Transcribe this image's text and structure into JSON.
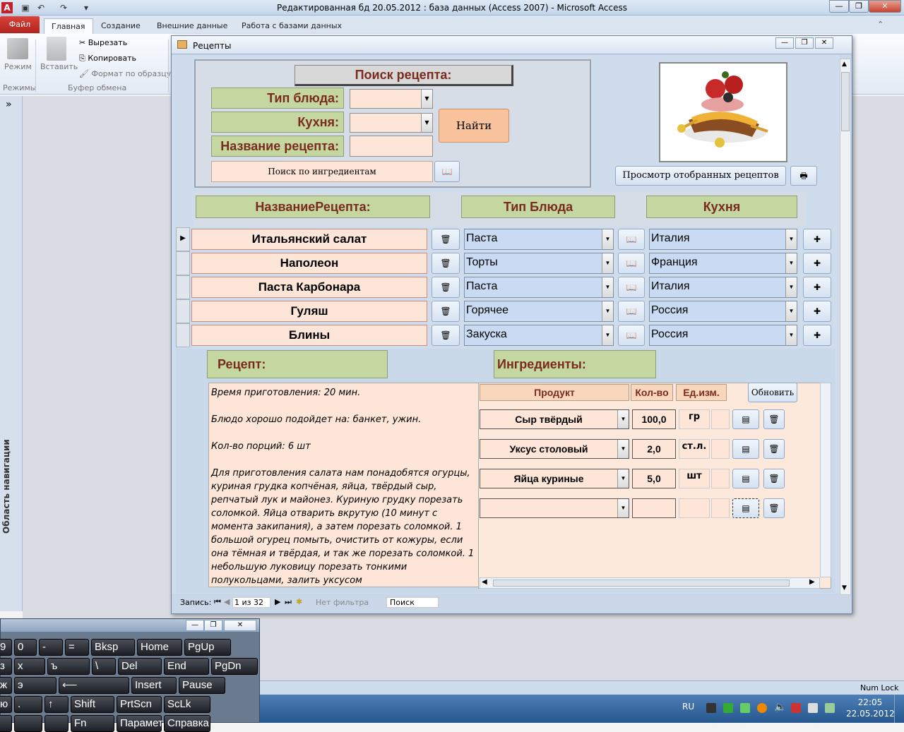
{
  "window": {
    "title": "Редактированная бд 20.05.2012 : база данных (Access 2007)  -  Microsoft Access"
  },
  "ribbon": {
    "file_tab": "Файл",
    "tabs": [
      "Главная",
      "Создание",
      "Внешние данные",
      "Работа с базами данных"
    ],
    "mode_label": "Режим",
    "paste_label": "Вставить",
    "cut": "Вырезать",
    "copy": "Копировать",
    "format_painter": "Формат по образцу",
    "group_modes": "Режимы",
    "group_clipboard": "Буфер обмена"
  },
  "navpane": {
    "label": "Область навигации",
    "toggle": "»"
  },
  "form": {
    "title": "Рецепты",
    "search": {
      "header": "Поиск рецепта:",
      "type_label": "Тип блюда:",
      "cuisine_label": "Кухня:",
      "name_label": "Название рецепта:",
      "find_button": "Найти",
      "ingredient_search": "Поиск по ингредиентам"
    },
    "view_selected": "Просмотр отобранных рецептов",
    "columns": [
      "НазваниеРецепта:",
      "Тип Блюда",
      "Кухня"
    ],
    "rows": [
      {
        "name": "Итальянский салат",
        "type": "Паста",
        "cuisine": "Италия"
      },
      {
        "name": "Наполеон",
        "type": "Торты",
        "cuisine": "Франция"
      },
      {
        "name": "Паста Карбонара",
        "type": "Паста",
        "cuisine": "Италия"
      },
      {
        "name": "Гуляш",
        "type": "Горячее",
        "cuisine": "Россия"
      },
      {
        "name": "Блины",
        "type": "Закуска",
        "cuisine": "Россия"
      }
    ],
    "recipe_label": "Рецепт:",
    "ingredients_label": "Ингредиенты:",
    "recipe_text": "Время приготовления: 20 мин.\n\nБлюдо хорошо подойдет на: банкет, ужин.\n\nКол-во порций: 6 шт\n\nДля приготовления салата нам понадобятся огурцы, куриная грудка копчёная, яйца, твёрдый сыр, репчатый лук и майонез. Куриную грудку порезать соломкой. Яйца отварить вкрутую (10 минут с момента закипания), а затем порезать соломкой. 1 большой огурец помыть, очистить от кожуры, если она тёмная и твёрдая, и так же порезать соломкой. 1 небольшую луковицу порезать тонкими полукольцами, залить уксусом",
    "ing_headers": {
      "product": "Продукт",
      "qty": "Кол-во",
      "unit": "Ед.изм.",
      "refresh": "Обновить"
    },
    "ingredients": [
      {
        "product": "Сыр твёрдый",
        "qty": "100,0",
        "unit": "гр"
      },
      {
        "product": "Уксус столовый",
        "qty": "2,0",
        "unit": "ст.л."
      },
      {
        "product": "Яйца куриные",
        "qty": "5,0",
        "unit": "шт"
      }
    ],
    "record_nav": {
      "label": "Запись:",
      "position": "1 из 32",
      "filter": "Нет фильтра",
      "search": "Поиск"
    }
  },
  "keyboard": {
    "rows": [
      [
        "9",
        "0",
        "-",
        "=",
        "Bksp",
        "Home",
        "PgUp"
      ],
      [
        "з",
        "х",
        "ъ",
        "\\",
        "Del",
        "End",
        "PgDn"
      ],
      [
        "ж",
        "э",
        "⟵",
        "Insert",
        "Pause"
      ],
      [
        "ю",
        ".",
        "↑",
        "Shift",
        "PrtScn",
        "ScLk"
      ],
      [
        "",
        "",
        "",
        "Fn",
        "Параметры",
        "Справка"
      ]
    ]
  },
  "status": {
    "numlock": "Num Lock"
  },
  "taskbar": {
    "lang": "RU",
    "time": "22:05",
    "date": "22.05.2012"
  }
}
